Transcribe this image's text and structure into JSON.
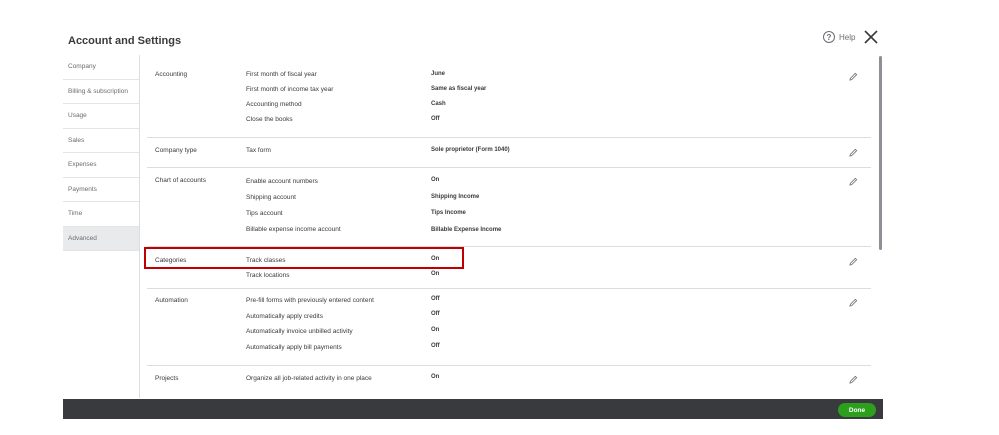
{
  "header": {
    "title": "Account and Settings",
    "help_label": "Help",
    "help_glyph": "?"
  },
  "sidebar": {
    "items": [
      {
        "label": "Company"
      },
      {
        "label": "Billing & subscription"
      },
      {
        "label": "Usage"
      },
      {
        "label": "Sales"
      },
      {
        "label": "Expenses"
      },
      {
        "label": "Payments"
      },
      {
        "label": "Time"
      },
      {
        "label": "Advanced",
        "active": true
      }
    ]
  },
  "sections": {
    "accounting": {
      "label": "Accounting",
      "rows": [
        {
          "label": "First month of fiscal year",
          "value": "June"
        },
        {
          "label": "First month of income tax year",
          "value": "Same as fiscal year"
        },
        {
          "label": "Accounting method",
          "value": "Cash"
        },
        {
          "label": "Close the books",
          "value": "Off"
        }
      ]
    },
    "company_type": {
      "label": "Company type",
      "rows": [
        {
          "label": "Tax form",
          "value": "Sole proprietor (Form 1040)"
        }
      ]
    },
    "chart_of_accounts": {
      "label": "Chart of accounts",
      "rows": [
        {
          "label": "Enable account numbers",
          "value": "On"
        },
        {
          "label": "Shipping account",
          "value": "Shipping Income"
        },
        {
          "label": "Tips account",
          "value": "Tips Income"
        },
        {
          "label": "Billable expense income account",
          "value": "Billable Expense Income"
        }
      ]
    },
    "categories": {
      "label": "Categories",
      "rows": [
        {
          "label": "Track classes",
          "value": "On"
        },
        {
          "label": "Track locations",
          "value": "On"
        }
      ]
    },
    "automation": {
      "label": "Automation",
      "rows": [
        {
          "label": "Pre-fill forms with previously entered content",
          "value": "Off"
        },
        {
          "label": "Automatically apply credits",
          "value": "Off"
        },
        {
          "label": "Automatically invoice unbilled activity",
          "value": "On"
        },
        {
          "label": "Automatically apply bill payments",
          "value": "Off"
        }
      ]
    },
    "projects": {
      "label": "Projects",
      "rows": [
        {
          "label": "Organize all job-related activity in one place",
          "value": "On"
        }
      ]
    }
  },
  "footer": {
    "done_label": "Done"
  },
  "colors": {
    "highlight": "#c00000",
    "done_green": "#2ca01c",
    "footer_bg": "#393a3d"
  },
  "icons": {
    "help": "help-circle-icon",
    "close": "close-icon",
    "edit": "pencil-icon"
  }
}
